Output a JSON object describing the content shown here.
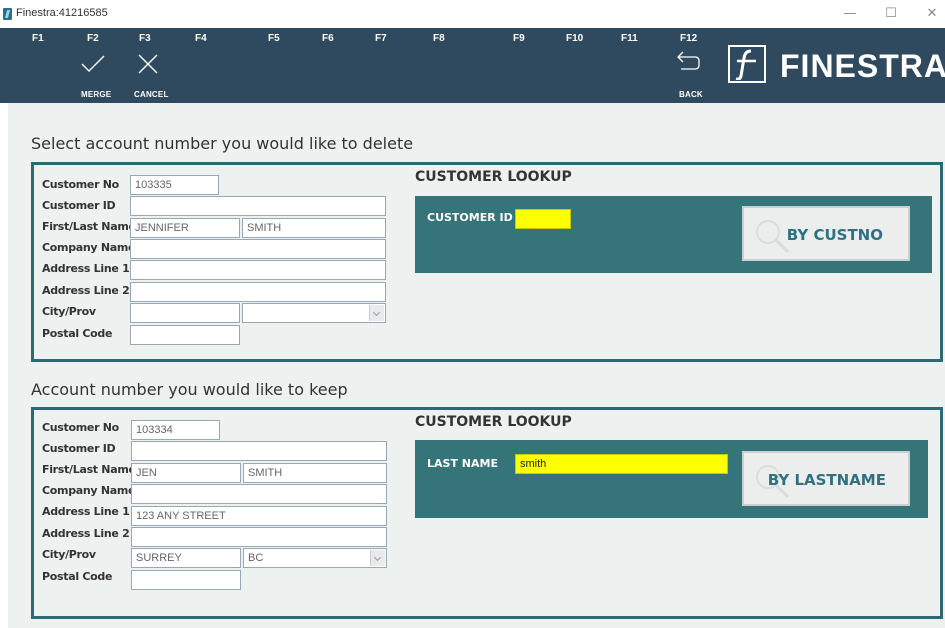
{
  "window": {
    "title": "Finestra:41216585",
    "minimize": "—",
    "maximize": "☐",
    "close": "✕"
  },
  "toolbar": {
    "fkeys": [
      "F1",
      "F2",
      "F3",
      "F4",
      "F5",
      "F6",
      "F7",
      "F8",
      "F9",
      "F10",
      "F11",
      "F12"
    ],
    "merge_label": "MERGE",
    "cancel_label": "CANCEL",
    "back_label": "BACK",
    "brand": "FINESTRA"
  },
  "delete_section": {
    "title": "Select account number you would like to delete",
    "labels": {
      "customer_no": "Customer No",
      "customer_id": "Customer ID",
      "first_last": "First/Last Name",
      "company": "Company Name",
      "addr1": "Address Line 1",
      "addr2": "Address Line 2",
      "city_prov": "City/Prov",
      "postal": "Postal Code"
    },
    "values": {
      "customer_no": "103335",
      "customer_id": "",
      "first_name": "JENNIFER",
      "last_name": "SMITH",
      "company": "",
      "addr1": "",
      "addr2": "",
      "city": "",
      "prov": "",
      "postal": ""
    },
    "lookup": {
      "title": "CUSTOMER LOOKUP",
      "field_label": "CUSTOMER ID",
      "field_value": "",
      "button_label": "BY CUSTNO"
    }
  },
  "keep_section": {
    "title": "Account number you would like to keep",
    "labels": {
      "customer_no": "Customer No",
      "customer_id": "Customer ID",
      "first_last": "First/Last Name",
      "company": "Company Name",
      "addr1": "Address Line 1",
      "addr2": "Address Line 2",
      "city_prov": "City/Prov",
      "postal": "Postal Code"
    },
    "values": {
      "customer_no": "103334",
      "customer_id": "",
      "first_name": "JEN",
      "last_name": "SMITH",
      "company": "",
      "addr1": "123 ANY STREET",
      "addr2": "",
      "city": "SURREY",
      "prov": "BC",
      "postal": ""
    },
    "lookup": {
      "title": "CUSTOMER LOOKUP",
      "field_label": "LAST NAME",
      "field_value": "smith",
      "button_label": "BY LASTNAME"
    }
  },
  "colors": {
    "toolbar_bg": "#2f4a5f",
    "panel_border": "#2d6a74",
    "lookup_bg": "#357478",
    "highlight": "#ffff00",
    "content_bg": "#edf1f0"
  }
}
